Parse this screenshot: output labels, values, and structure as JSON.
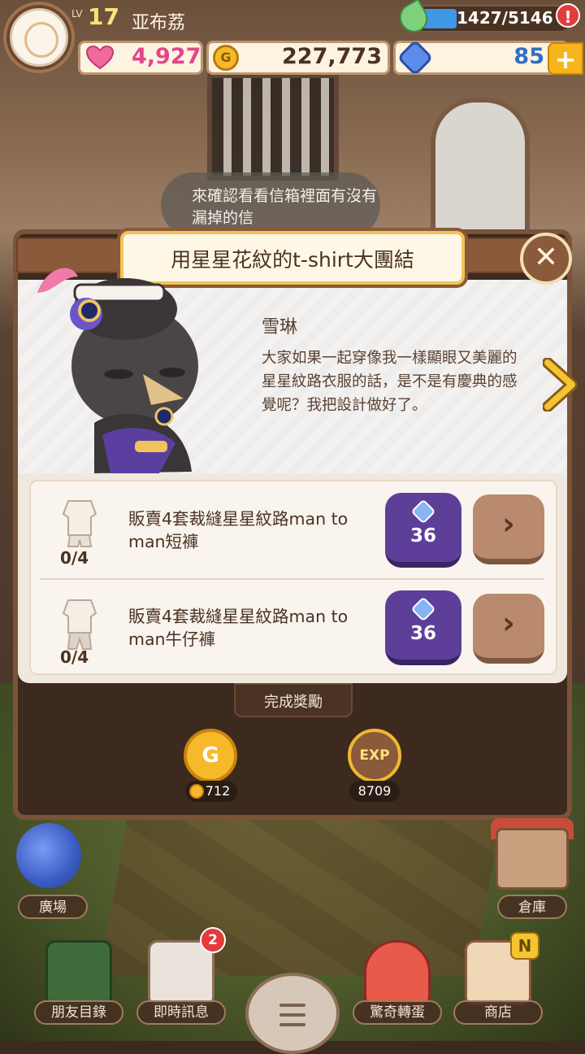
{
  "player": {
    "level_label": "LV",
    "level": "17",
    "name": "亚布荔",
    "exp": "1427/5146",
    "exp_progress": 0.28,
    "alert": "!"
  },
  "resources": {
    "hearts": "4,927",
    "coins": "227,773",
    "gems": "85",
    "add_label": "+"
  },
  "background": {
    "speech": "來確認看看信箱裡面有沒有漏掉的信"
  },
  "quest": {
    "title": "用星星花紋的t-shirt大團結",
    "close_label": "✕",
    "npc_name": "雪琳",
    "npc_line": "大家如果一起穿像我一樣顯眼又美麗的星星紋路衣服的話，是不是有慶典的感覺呢？我把設計做好了。",
    "tasks": [
      {
        "label": "販賣4套裁縫星星紋路man to man短褲",
        "progress": "0/4",
        "gem_cost": "36",
        "go_label": "›"
      },
      {
        "label": "販賣4套裁縫星星紋路man to man牛仔褲",
        "progress": "0/4",
        "gem_cost": "36",
        "go_label": "›"
      }
    ],
    "reward_label": "完成獎勵",
    "rewards": {
      "gold_icon_text": "G",
      "gold": "712",
      "exp_icon_text": "EXP",
      "exp": "8709"
    }
  },
  "places": {
    "plaza": "廣場",
    "storage": "倉庫"
  },
  "nav": {
    "friends": "朋友目錄",
    "messages": "即時訊息",
    "messages_badge": "2",
    "gacha": "驚奇轉蛋",
    "shop": "商店",
    "shop_badge": "N"
  }
}
